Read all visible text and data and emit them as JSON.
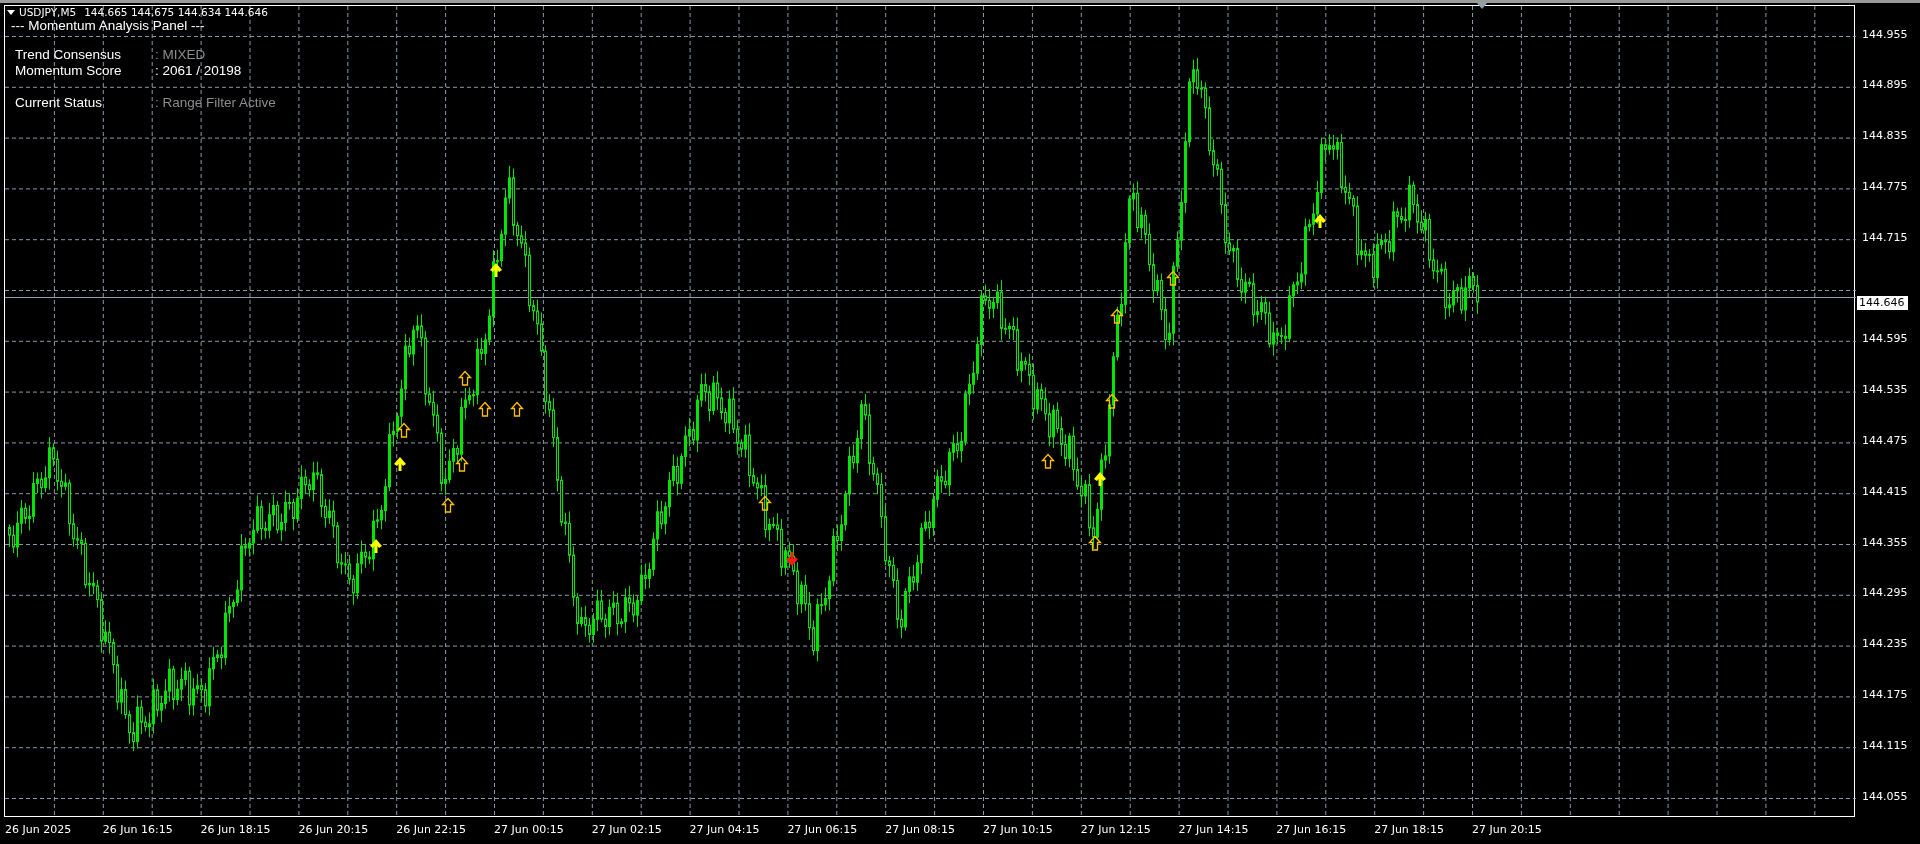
{
  "symbol_bar": {
    "symbol": "USDJPY,M5",
    "ohlc": "144.665 144.675 144.634 144.646"
  },
  "panel": {
    "title": "--- Momentum Analysis Panel ---",
    "rows": [
      {
        "label": "Trend Consensus",
        "value": ": MIXED",
        "dimmed": true,
        "separated": false
      },
      {
        "label": "Momentum Score",
        "value": ": 2061 / 20198",
        "dimmed": false,
        "separated": false
      },
      {
        "label": "Current Status",
        "value": ": Range Filter Active",
        "dimmed": true,
        "separated": true
      }
    ]
  },
  "price_axis": {
    "labels": [
      {
        "kind": "tick",
        "text": "144.955"
      },
      {
        "kind": "tick",
        "text": "144.895"
      },
      {
        "kind": "tick",
        "text": "144.835"
      },
      {
        "kind": "tick",
        "text": "144.775"
      },
      {
        "kind": "tick",
        "text": "144.715"
      },
      {
        "kind": "current",
        "text": "144.646"
      },
      {
        "kind": "tick",
        "text": "144.595"
      },
      {
        "kind": "tick",
        "text": "144.535"
      },
      {
        "kind": "tick",
        "text": "144.475"
      },
      {
        "kind": "tick",
        "text": "144.415"
      },
      {
        "kind": "tick",
        "text": "144.355"
      },
      {
        "kind": "tick",
        "text": "144.295"
      },
      {
        "kind": "tick",
        "text": "144.235"
      },
      {
        "kind": "tick",
        "text": "144.175"
      },
      {
        "kind": "tick",
        "text": "144.115"
      },
      {
        "kind": "tick",
        "text": "144.055"
      }
    ]
  },
  "time_axis": {
    "labels": [
      "26 Jun 2025",
      "26 Jun 16:15",
      "26 Jun 18:15",
      "26 Jun 20:15",
      "26 Jun 22:15",
      "27 Jun 00:15",
      "27 Jun 02:15",
      "27 Jun 04:15",
      "27 Jun 06:15",
      "27 Jun 08:15",
      "27 Jun 10:15",
      "27 Jun 12:15",
      "27 Jun 14:15",
      "27 Jun 16:15",
      "27 Jun 18:15",
      "27 Jun 20:15"
    ]
  }
}
